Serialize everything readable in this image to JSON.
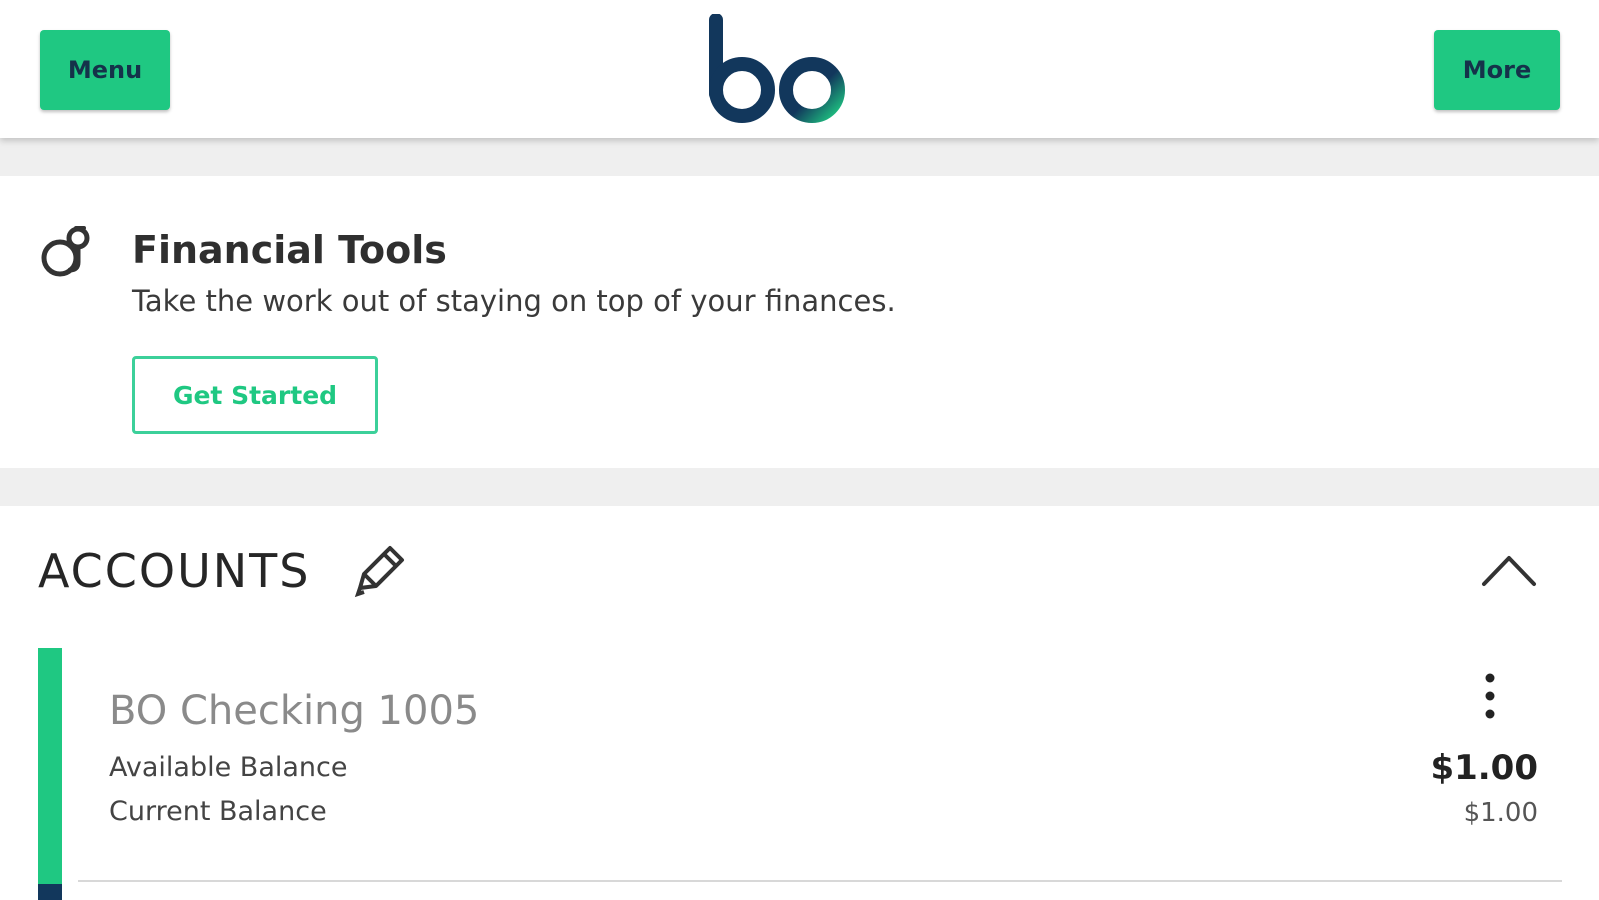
{
  "header": {
    "menu_label": "Menu",
    "more_label": "More",
    "logo_text": "bo"
  },
  "financial_tools": {
    "icon": "piggy-bank-icon",
    "title": "Financial Tools",
    "description": "Take the work out of staying on top of your finances.",
    "cta_label": "Get Started"
  },
  "accounts": {
    "title": "ACCOUNTS",
    "edit_icon": "pencil-icon",
    "collapse_icon": "chevron-up-icon",
    "items": [
      {
        "name": "BO Checking 1005",
        "available_label": "Available Balance",
        "current_label": "Current Balance",
        "available_value": "$1.00",
        "current_value": "$1.00",
        "menu_icon": "kebab-menu-icon",
        "accent_color": "#1fc882"
      }
    ]
  },
  "colors": {
    "brand_green": "#1fc882",
    "brand_navy": "#12375c",
    "background": "#efefef"
  }
}
